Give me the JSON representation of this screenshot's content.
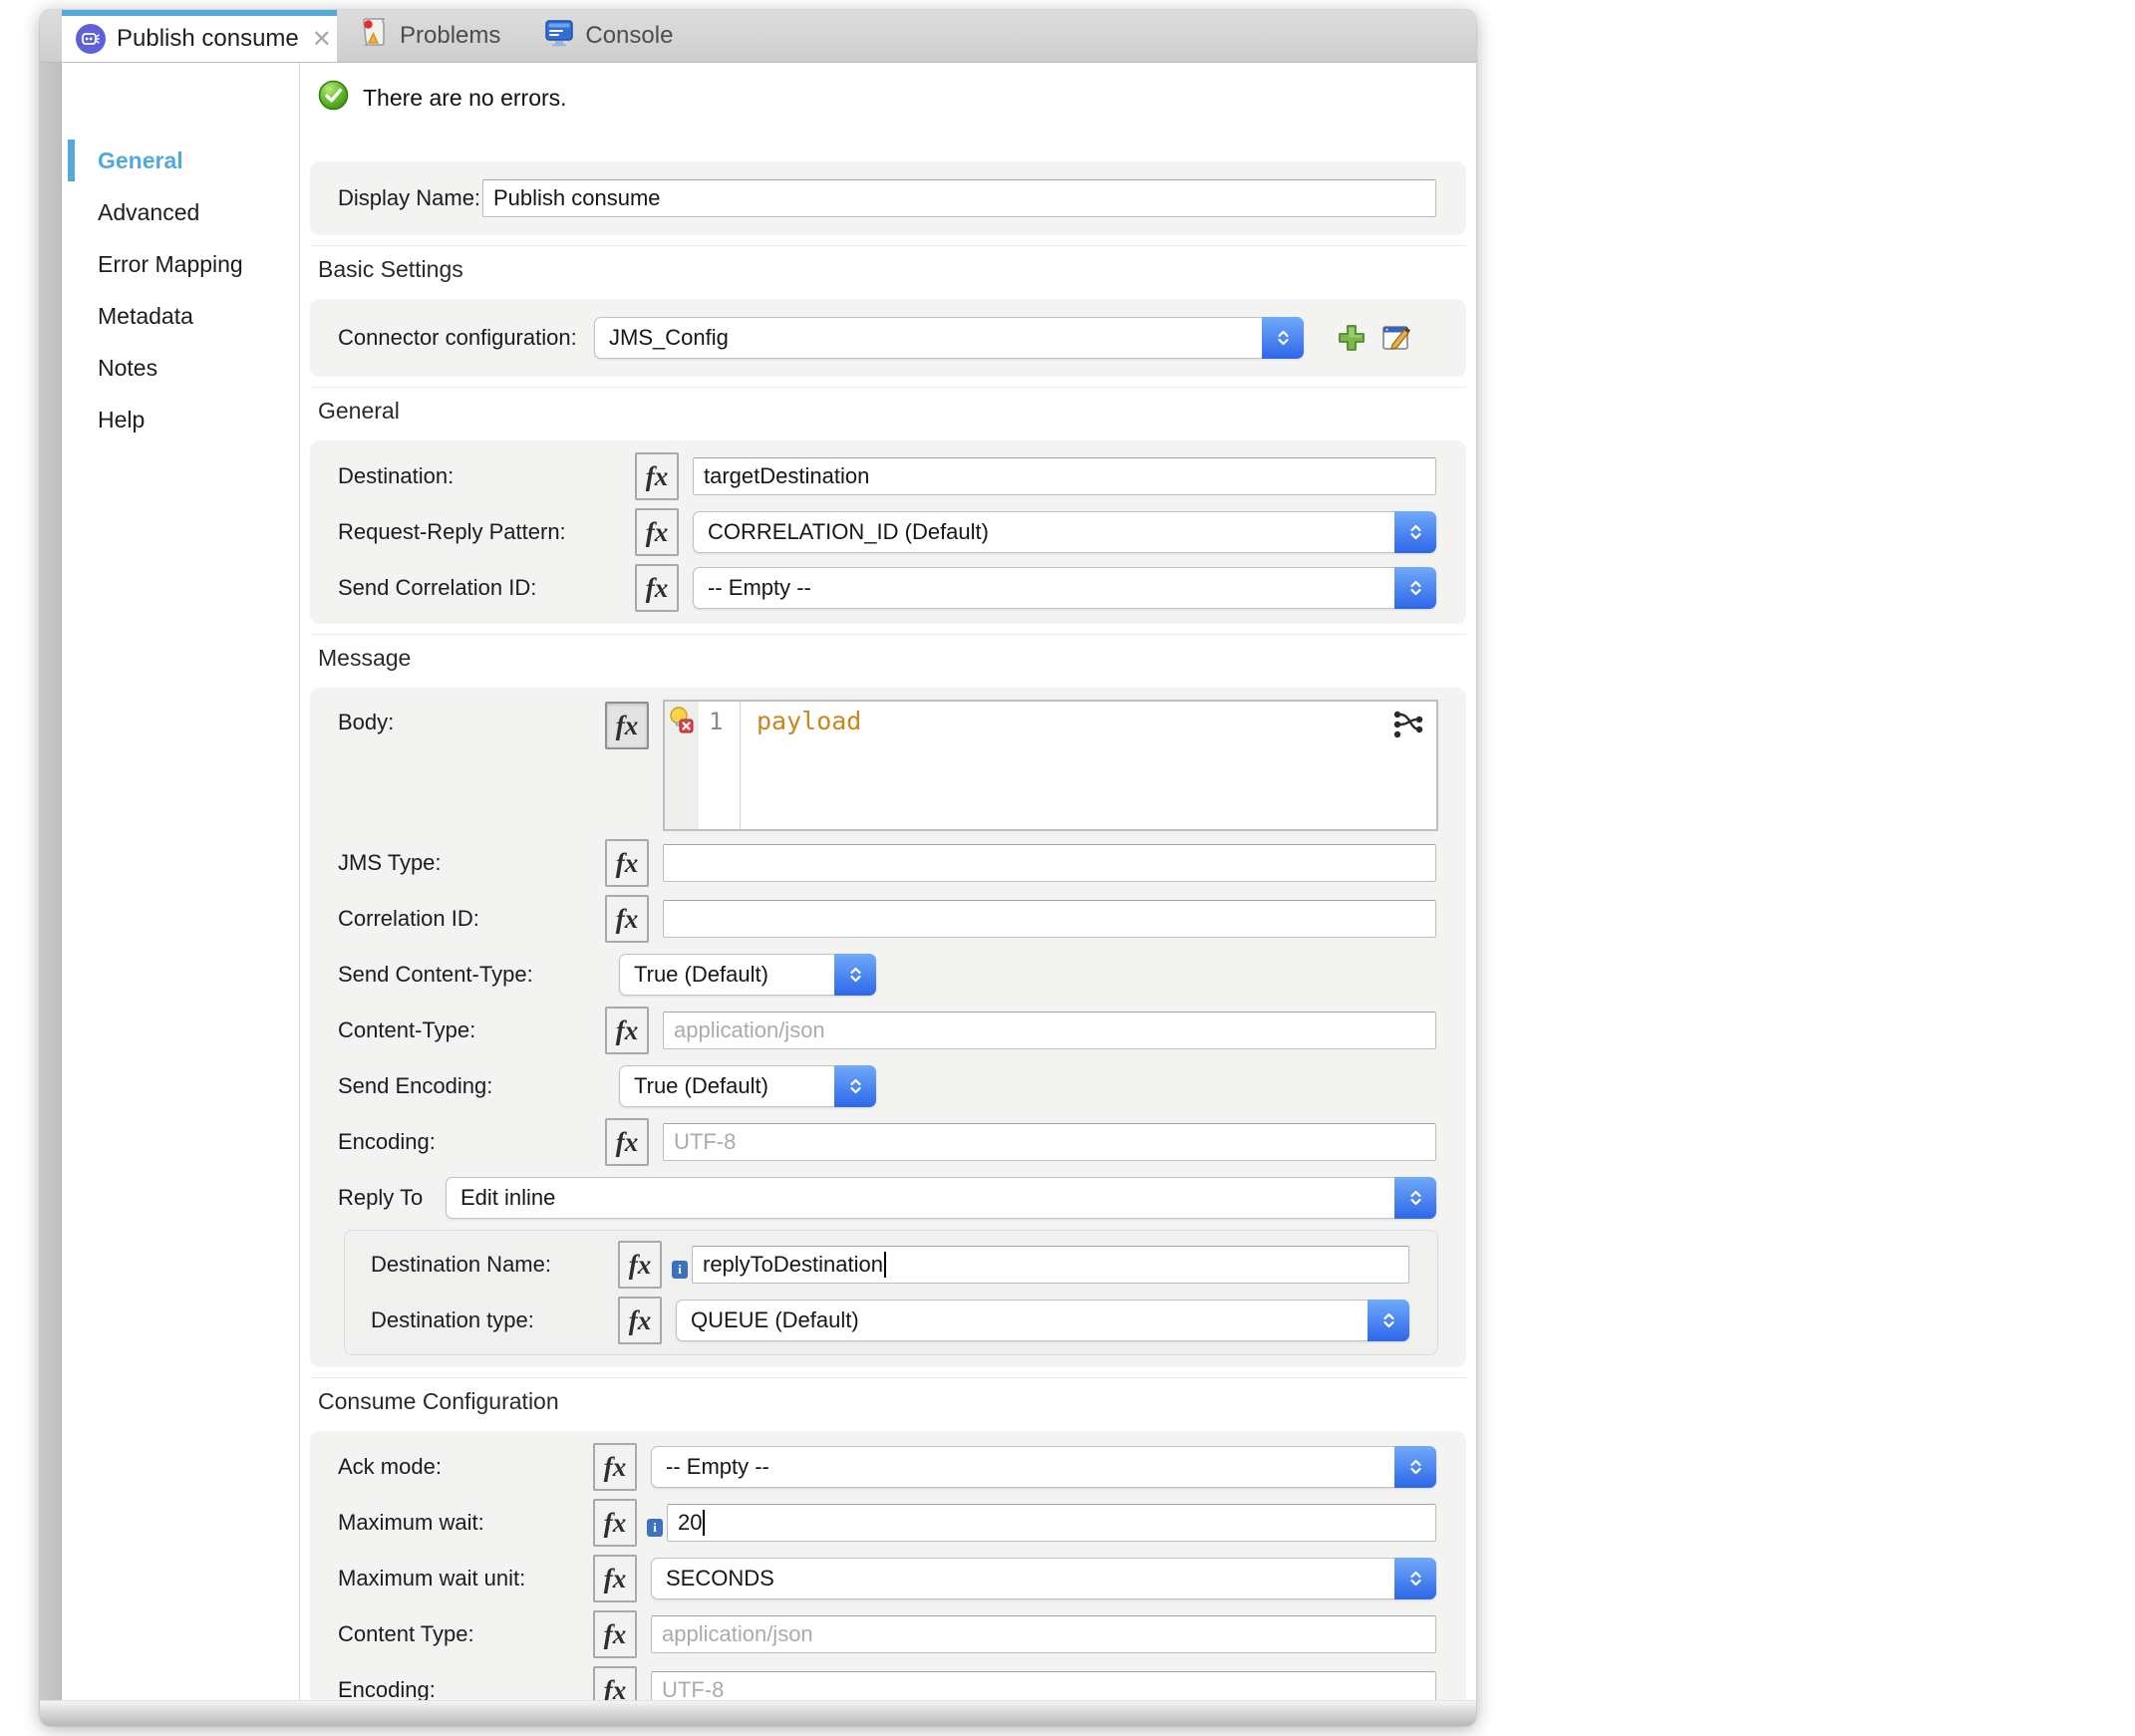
{
  "icons": {
    "fx": "fx",
    "close": "✕"
  },
  "colors": {
    "accent_blue": "#54a9db",
    "select_blue": "#2e67e8",
    "code_orange": "#c8871c",
    "status_green": "#53b82d",
    "tab_icon_indigo": "#5f61da"
  },
  "tabbar": {
    "active_tab": "Publish consume",
    "tabs": [
      {
        "label": "Problems"
      },
      {
        "label": "Console"
      }
    ]
  },
  "status": {
    "message": "There are no errors."
  },
  "sidebar": {
    "items": [
      {
        "label": "General",
        "active": true
      },
      {
        "label": "Advanced",
        "active": false
      },
      {
        "label": "Error Mapping",
        "active": false
      },
      {
        "label": "Metadata",
        "active": false
      },
      {
        "label": "Notes",
        "active": false
      },
      {
        "label": "Help",
        "active": false
      }
    ]
  },
  "form": {
    "display_name": {
      "label": "Display Name:",
      "value": "Publish consume"
    },
    "basic_settings": {
      "title": "Basic Settings",
      "connector_configuration": {
        "label": "Connector configuration:",
        "value": "JMS_Config"
      }
    },
    "general": {
      "title": "General",
      "destination": {
        "label": "Destination:",
        "value": "targetDestination"
      },
      "request_reply_pattern": {
        "label": "Request-Reply Pattern:",
        "value": "CORRELATION_ID (Default)"
      },
      "send_correlation_id": {
        "label": "Send Correlation ID:",
        "value": "-- Empty --"
      }
    },
    "message": {
      "title": "Message",
      "body": {
        "label": "Body:",
        "line_number": "1",
        "code": "payload"
      },
      "jms_type": {
        "label": "JMS Type:",
        "value": ""
      },
      "correlation_id": {
        "label": "Correlation ID:",
        "value": ""
      },
      "send_content_type": {
        "label": "Send Content-Type:",
        "value": "True (Default)"
      },
      "content_type": {
        "label": "Content-Type:",
        "placeholder": "application/json"
      },
      "send_encoding": {
        "label": "Send Encoding:",
        "value": "True (Default)"
      },
      "encoding": {
        "label": "Encoding:",
        "placeholder": "UTF-8"
      },
      "reply_to": {
        "label": "Reply To",
        "value": "Edit inline"
      },
      "reply_panel": {
        "destination_name": {
          "label": "Destination Name:",
          "value": "replyToDestination"
        },
        "destination_type": {
          "label": "Destination type:",
          "value": "QUEUE (Default)"
        }
      }
    },
    "consume_configuration": {
      "title": "Consume Configuration",
      "ack_mode": {
        "label": "Ack mode:",
        "value": "-- Empty --"
      },
      "maximum_wait": {
        "label": "Maximum wait:",
        "value": "20"
      },
      "maximum_wait_unit": {
        "label": "Maximum wait unit:",
        "value": "SECONDS"
      },
      "content_type": {
        "label": "Content Type:",
        "placeholder": "application/json"
      },
      "encoding": {
        "label": "Encoding:",
        "placeholder": "UTF-8"
      }
    }
  }
}
